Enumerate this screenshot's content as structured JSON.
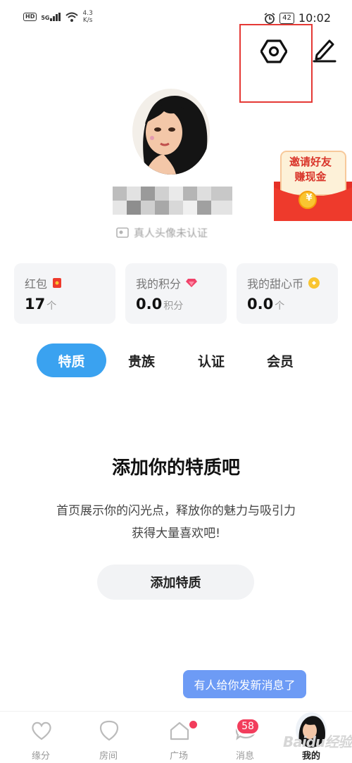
{
  "status_bar": {
    "hd": "HD",
    "signal": "5G",
    "net_speed_value": "4.3",
    "net_speed_unit": "K/s",
    "battery": "42",
    "time": "10:02"
  },
  "header": {
    "settings_icon": "hexagon-settings-icon",
    "edit_icon": "pencil-icon",
    "highlight_color": "#e53935"
  },
  "profile": {
    "verify_text": "真人头像未认证"
  },
  "invite_banner": {
    "line1": "邀请好友",
    "line2": "赚现金",
    "coin": "¥"
  },
  "cards": [
    {
      "label": "红包",
      "value": "17",
      "unit": "个",
      "icon": "red-packet-icon"
    },
    {
      "label": "我的积分",
      "value": "0.0",
      "unit": "积分",
      "icon": "diamond-icon"
    },
    {
      "label": "我的甜心币",
      "value": "0.0",
      "unit": "个",
      "icon": "coin-icon"
    }
  ],
  "tabs": [
    {
      "label": "特质",
      "active": true
    },
    {
      "label": "贵族",
      "active": false
    },
    {
      "label": "认证",
      "active": false
    },
    {
      "label": "会员",
      "active": false
    }
  ],
  "empty_state": {
    "title": "添加你的特质吧",
    "desc_line1": "首页展示你的闪光点，释放你的魅力与吸引力",
    "desc_line2": "获得大量喜欢吧!",
    "button": "添加特质"
  },
  "toast": "有人给你发新消息了",
  "bottom_nav": [
    {
      "label": "缘分",
      "icon": "heart-icon"
    },
    {
      "label": "房间",
      "icon": "heart-outline-icon"
    },
    {
      "label": "广场",
      "icon": "home-icon"
    },
    {
      "label": "消息",
      "icon": "chat-icon",
      "badge": "58"
    },
    {
      "label": "我的",
      "icon": "avatar-icon",
      "active": true
    }
  ],
  "watermark": "Baidu经验",
  "colors": {
    "accent": "#3aa2f0",
    "toast": "#6d9bf5",
    "badge": "#f23d5c"
  }
}
